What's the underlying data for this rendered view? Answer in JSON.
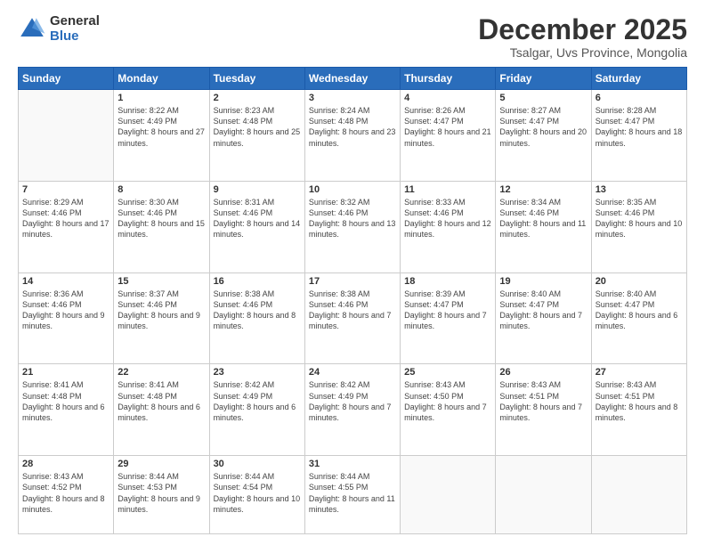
{
  "logo": {
    "general": "General",
    "blue": "Blue"
  },
  "header": {
    "month": "December 2025",
    "location": "Tsalgar, Uvs Province, Mongolia"
  },
  "days_of_week": [
    "Sunday",
    "Monday",
    "Tuesday",
    "Wednesday",
    "Thursday",
    "Friday",
    "Saturday"
  ],
  "weeks": [
    [
      {
        "num": "",
        "empty": true
      },
      {
        "num": "1",
        "sunrise": "8:22 AM",
        "sunset": "4:49 PM",
        "daylight": "8 hours and 27 minutes."
      },
      {
        "num": "2",
        "sunrise": "8:23 AM",
        "sunset": "4:48 PM",
        "daylight": "8 hours and 25 minutes."
      },
      {
        "num": "3",
        "sunrise": "8:24 AM",
        "sunset": "4:48 PM",
        "daylight": "8 hours and 23 minutes."
      },
      {
        "num": "4",
        "sunrise": "8:26 AM",
        "sunset": "4:47 PM",
        "daylight": "8 hours and 21 minutes."
      },
      {
        "num": "5",
        "sunrise": "8:27 AM",
        "sunset": "4:47 PM",
        "daylight": "8 hours and 20 minutes."
      },
      {
        "num": "6",
        "sunrise": "8:28 AM",
        "sunset": "4:47 PM",
        "daylight": "8 hours and 18 minutes."
      }
    ],
    [
      {
        "num": "7",
        "sunrise": "8:29 AM",
        "sunset": "4:46 PM",
        "daylight": "8 hours and 17 minutes."
      },
      {
        "num": "8",
        "sunrise": "8:30 AM",
        "sunset": "4:46 PM",
        "daylight": "8 hours and 15 minutes."
      },
      {
        "num": "9",
        "sunrise": "8:31 AM",
        "sunset": "4:46 PM",
        "daylight": "8 hours and 14 minutes."
      },
      {
        "num": "10",
        "sunrise": "8:32 AM",
        "sunset": "4:46 PM",
        "daylight": "8 hours and 13 minutes."
      },
      {
        "num": "11",
        "sunrise": "8:33 AM",
        "sunset": "4:46 PM",
        "daylight": "8 hours and 12 minutes."
      },
      {
        "num": "12",
        "sunrise": "8:34 AM",
        "sunset": "4:46 PM",
        "daylight": "8 hours and 11 minutes."
      },
      {
        "num": "13",
        "sunrise": "8:35 AM",
        "sunset": "4:46 PM",
        "daylight": "8 hours and 10 minutes."
      }
    ],
    [
      {
        "num": "14",
        "sunrise": "8:36 AM",
        "sunset": "4:46 PM",
        "daylight": "8 hours and 9 minutes."
      },
      {
        "num": "15",
        "sunrise": "8:37 AM",
        "sunset": "4:46 PM",
        "daylight": "8 hours and 9 minutes."
      },
      {
        "num": "16",
        "sunrise": "8:38 AM",
        "sunset": "4:46 PM",
        "daylight": "8 hours and 8 minutes."
      },
      {
        "num": "17",
        "sunrise": "8:38 AM",
        "sunset": "4:46 PM",
        "daylight": "8 hours and 7 minutes."
      },
      {
        "num": "18",
        "sunrise": "8:39 AM",
        "sunset": "4:47 PM",
        "daylight": "8 hours and 7 minutes."
      },
      {
        "num": "19",
        "sunrise": "8:40 AM",
        "sunset": "4:47 PM",
        "daylight": "8 hours and 7 minutes."
      },
      {
        "num": "20",
        "sunrise": "8:40 AM",
        "sunset": "4:47 PM",
        "daylight": "8 hours and 6 minutes."
      }
    ],
    [
      {
        "num": "21",
        "sunrise": "8:41 AM",
        "sunset": "4:48 PM",
        "daylight": "8 hours and 6 minutes."
      },
      {
        "num": "22",
        "sunrise": "8:41 AM",
        "sunset": "4:48 PM",
        "daylight": "8 hours and 6 minutes."
      },
      {
        "num": "23",
        "sunrise": "8:42 AM",
        "sunset": "4:49 PM",
        "daylight": "8 hours and 6 minutes."
      },
      {
        "num": "24",
        "sunrise": "8:42 AM",
        "sunset": "4:49 PM",
        "daylight": "8 hours and 7 minutes."
      },
      {
        "num": "25",
        "sunrise": "8:43 AM",
        "sunset": "4:50 PM",
        "daylight": "8 hours and 7 minutes."
      },
      {
        "num": "26",
        "sunrise": "8:43 AM",
        "sunset": "4:51 PM",
        "daylight": "8 hours and 7 minutes."
      },
      {
        "num": "27",
        "sunrise": "8:43 AM",
        "sunset": "4:51 PM",
        "daylight": "8 hours and 8 minutes."
      }
    ],
    [
      {
        "num": "28",
        "sunrise": "8:43 AM",
        "sunset": "4:52 PM",
        "daylight": "8 hours and 8 minutes."
      },
      {
        "num": "29",
        "sunrise": "8:44 AM",
        "sunset": "4:53 PM",
        "daylight": "8 hours and 9 minutes."
      },
      {
        "num": "30",
        "sunrise": "8:44 AM",
        "sunset": "4:54 PM",
        "daylight": "8 hours and 10 minutes."
      },
      {
        "num": "31",
        "sunrise": "8:44 AM",
        "sunset": "4:55 PM",
        "daylight": "8 hours and 11 minutes."
      },
      {
        "num": "",
        "empty": true
      },
      {
        "num": "",
        "empty": true
      },
      {
        "num": "",
        "empty": true
      }
    ]
  ]
}
